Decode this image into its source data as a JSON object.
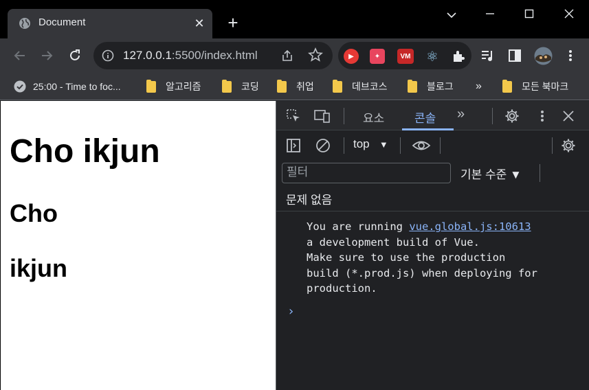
{
  "tab": {
    "title": "Document",
    "close": "✕",
    "new_tab": "+"
  },
  "window_controls": {
    "dropdown": "⌄",
    "minimize": "—",
    "maximize": "☐",
    "close": "✕"
  },
  "toolbar": {
    "url_host": "127.0.0.1",
    "url_rest": ":5500/index.html",
    "extensions": [
      {
        "name": "youtube-ext",
        "color": "#e53935",
        "glyph": "▶"
      },
      {
        "name": "sparkle-ext",
        "color": "#e8455e",
        "glyph": "✦"
      },
      {
        "name": "vm-ext",
        "color": "#c62828",
        "glyph": "VM"
      },
      {
        "name": "react-ext",
        "color": "#202124",
        "glyph": "⚛"
      },
      {
        "name": "puzzle-ext",
        "color": "#202124",
        "glyph": "✚"
      }
    ]
  },
  "bookmarks": [
    {
      "label": "25:00 - Time to foc...",
      "icon": "check-circle-icon"
    },
    {
      "label": "알고리즘",
      "icon": "folder-icon"
    },
    {
      "label": "코딩",
      "icon": "folder-icon"
    },
    {
      "label": "취업",
      "icon": "folder-icon"
    },
    {
      "label": "데브코스",
      "icon": "folder-icon"
    },
    {
      "label": "블로그",
      "icon": "folder-icon"
    },
    {
      "label": "»",
      "icon": ""
    },
    {
      "label": "모든 북마크",
      "icon": "folder-icon"
    }
  ],
  "page": {
    "heading1": "Cho ikjun",
    "heading2a": "Cho",
    "heading2b": "ikjun"
  },
  "devtools": {
    "tabs": [
      "요소",
      "콘솔"
    ],
    "active_tab": "콘솔",
    "more": "»",
    "context": "top",
    "context_arrow": "▼",
    "filter_placeholder": "필터",
    "levels": "기본 수준 ▼",
    "issues": "문제 없음",
    "message": {
      "line1_prefix": "You are running ",
      "link": "vue.global.js:10613",
      "line2": "a development build of Vue.",
      "line3": "Make sure to use the production",
      "line4": "build (*.prod.js) when deploying for",
      "line5": "production."
    },
    "prompt": "›"
  },
  "colors": {
    "accent": "#8ab4f8",
    "toolbar": "#35363a",
    "titlebar": "#000000"
  }
}
